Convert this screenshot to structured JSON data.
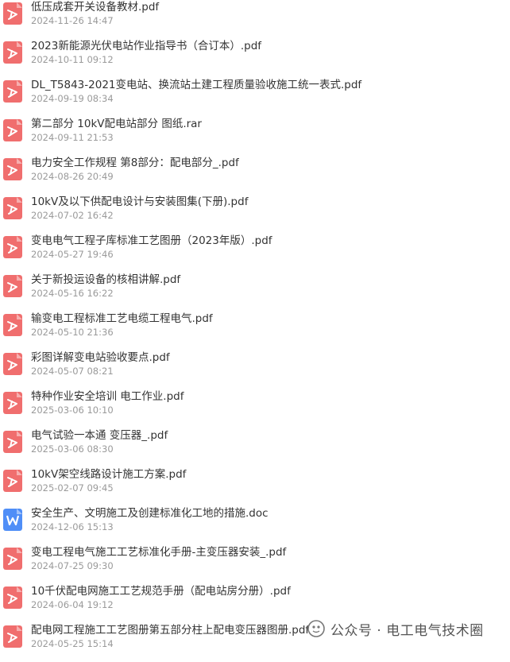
{
  "files": [
    {
      "name": "低压成套开关设备教材.pdf",
      "date": "2024-11-26 14:47",
      "type": "pdf"
    },
    {
      "name": "2023新能源光伏电站作业指导书（合订本）.pdf",
      "date": "2024-10-11 09:12",
      "type": "pdf"
    },
    {
      "name": "DL_T5843-2021变电站、换流站土建工程质量验收施工统一表式.pdf",
      "date": "2024-09-19 08:34",
      "type": "pdf"
    },
    {
      "name": "第二部分 10kV配电站部分 图纸.rar",
      "date": "2024-09-11 21:53",
      "type": "pdf"
    },
    {
      "name": "电力安全工作规程 第8部分：配电部分_.pdf",
      "date": "2024-08-26 20:49",
      "type": "pdf"
    },
    {
      "name": "10kV及以下供配电设计与安装图集(下册).pdf",
      "date": "2024-07-02 16:42",
      "type": "pdf"
    },
    {
      "name": "变电电气工程子库标准工艺图册（2023年版）.pdf",
      "date": "2024-05-27 19:46",
      "type": "pdf"
    },
    {
      "name": "关于新投运设备的核相讲解.pdf",
      "date": "2024-05-16 16:22",
      "type": "pdf"
    },
    {
      "name": "输变电工程标准工艺电缆工程电气.pdf",
      "date": "2024-05-10 21:36",
      "type": "pdf"
    },
    {
      "name": "彩图详解变电站验收要点.pdf",
      "date": "2024-05-07 08:21",
      "type": "pdf"
    },
    {
      "name": "特种作业安全培训 电工作业.pdf",
      "date": "2025-03-06 10:10",
      "type": "pdf"
    },
    {
      "name": "电气试验一本通 变压器_.pdf",
      "date": "2025-03-06 08:30",
      "type": "pdf"
    },
    {
      "name": "10kV架空线路设计施工方案.pdf",
      "date": "2025-02-07 09:45",
      "type": "pdf"
    },
    {
      "name": "安全生产、文明施工及创建标准化工地的措施.doc",
      "date": "2024-12-06 15:13",
      "type": "doc"
    },
    {
      "name": "变电工程电气施工工艺标准化手册-主变压器安装_.pdf",
      "date": "2024-07-25 09:30",
      "type": "pdf"
    },
    {
      "name": "10千伏配电网施工工艺规范手册（配电站房分册）.pdf",
      "date": "2024-06-04 19:12",
      "type": "pdf"
    },
    {
      "name": "配电网工程施工工艺图册第五部分柱上配电变压器图册.pdf",
      "date": "2024-05-25 15:14",
      "type": "pdf"
    }
  ],
  "watermark": {
    "text": "公众号 · 电工电气技术圈"
  },
  "colors": {
    "pdf_icon": "#f06e6e",
    "doc_icon": "#4f8ef7",
    "filename": "#333333",
    "date": "#9a9a9a"
  }
}
